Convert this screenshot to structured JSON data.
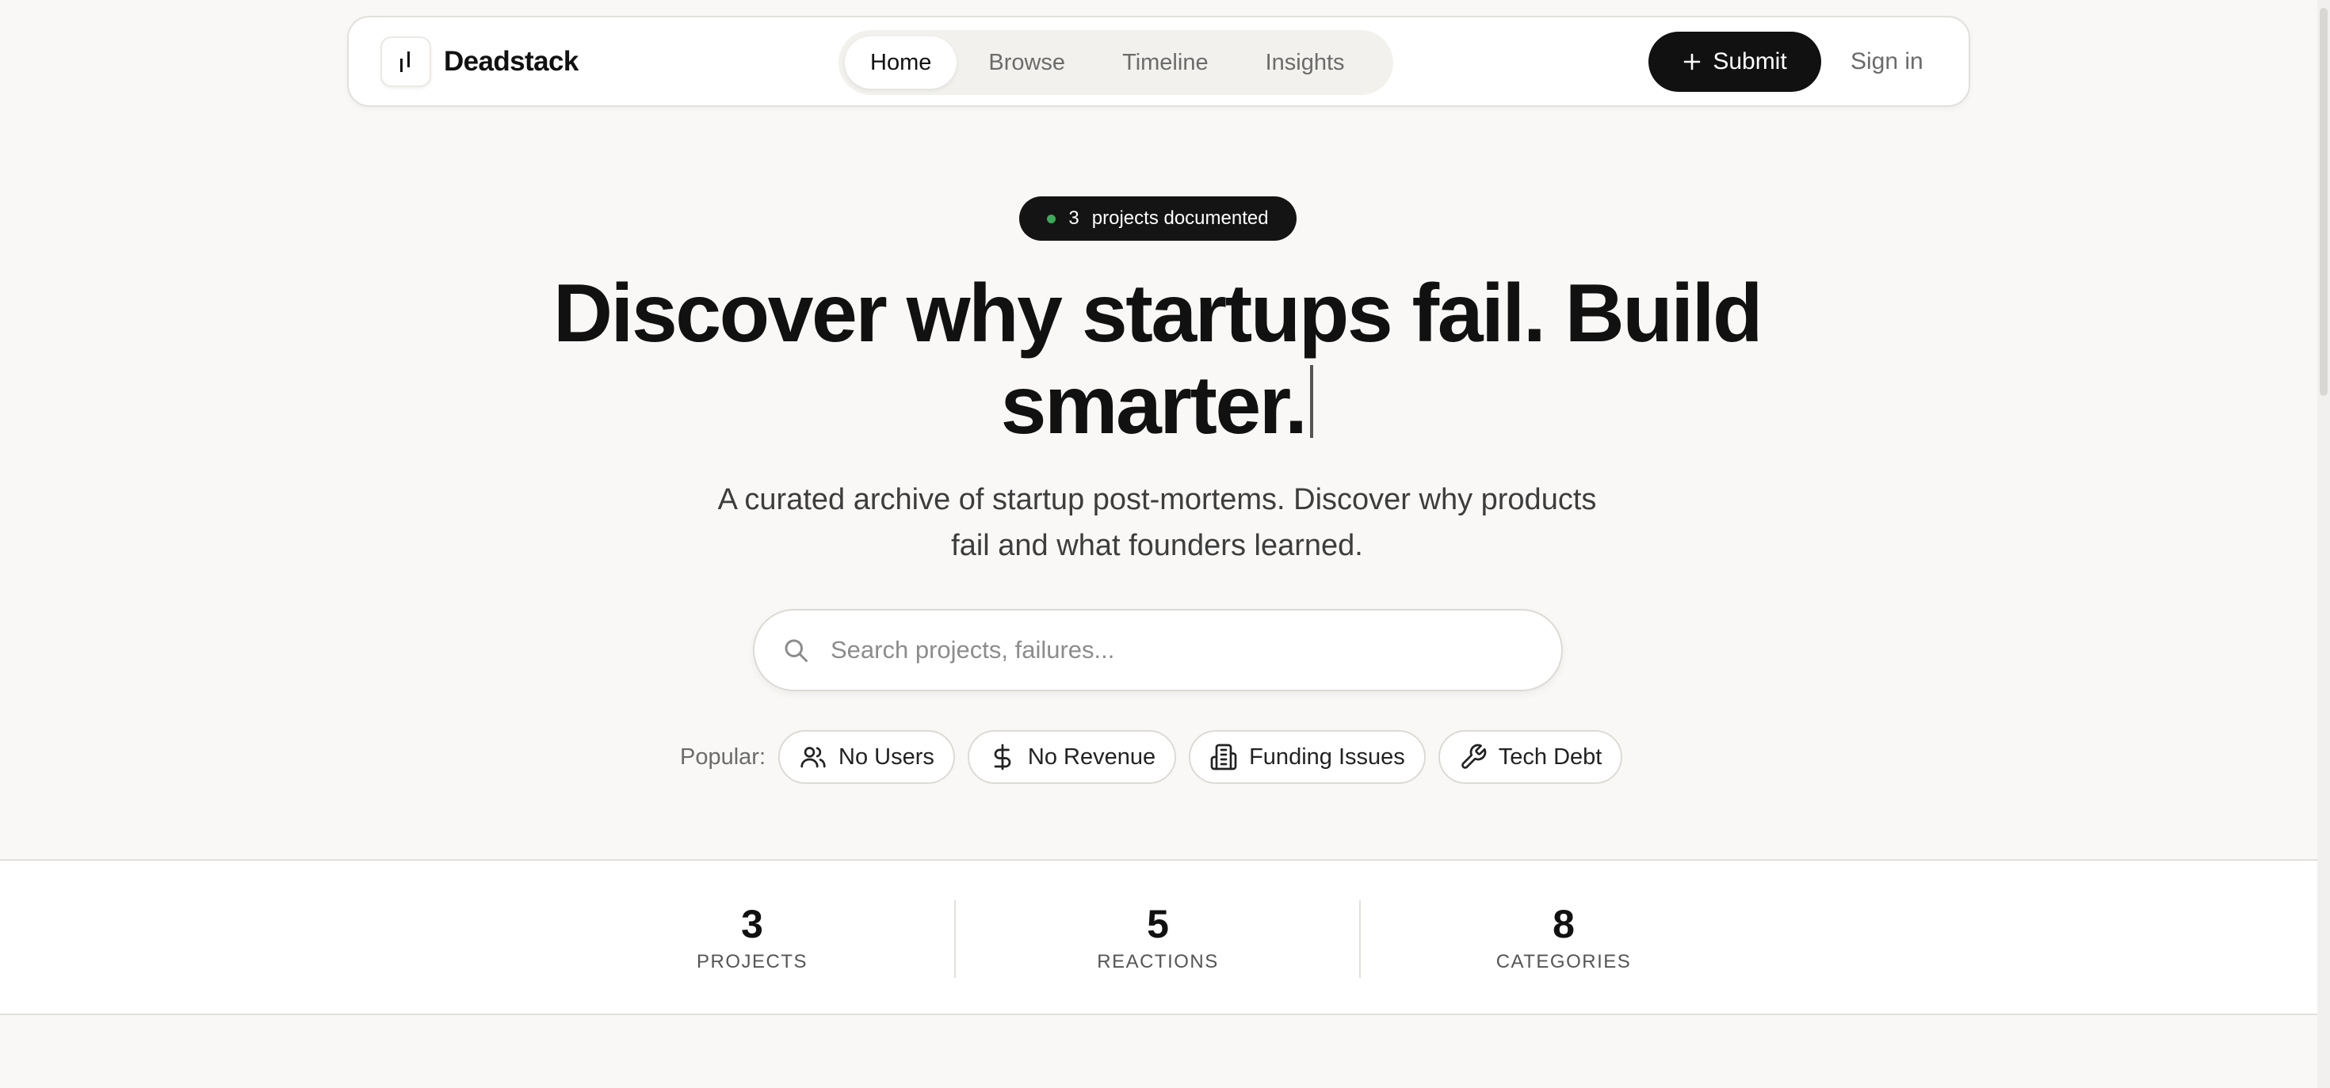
{
  "header": {
    "brand": "Deadstack",
    "nav": [
      {
        "label": "Home",
        "active": true
      },
      {
        "label": "Browse"
      },
      {
        "label": "Timeline"
      },
      {
        "label": "Insights"
      }
    ],
    "submit_label": "Submit",
    "signin_label": "Sign in"
  },
  "hero": {
    "badge_count": "3",
    "badge_text": "projects documented",
    "title_line1": "Discover why startups fail. Build",
    "title_line2": "smarter.",
    "subtitle_line1": "A curated archive of startup post-mortems. Discover why products",
    "subtitle_line2": "fail and what founders learned."
  },
  "search": {
    "placeholder": "Search projects, failures...",
    "value": ""
  },
  "popular": {
    "label": "Popular:",
    "tags": [
      {
        "label": "No Users",
        "icon": "users-icon"
      },
      {
        "label": "No Revenue",
        "icon": "dollar-icon"
      },
      {
        "label": "Funding Issues",
        "icon": "building-icon"
      },
      {
        "label": "Tech Debt",
        "icon": "wrench-icon"
      }
    ]
  },
  "stats": [
    {
      "value": "3",
      "label": "PROJECTS"
    },
    {
      "value": "5",
      "label": "REACTIONS"
    },
    {
      "value": "8",
      "label": "CATEGORIES"
    }
  ],
  "colors": {
    "background": "#f9f8f6",
    "primary": "#111111",
    "live_dot": "#3fa95b",
    "muted_text": "#6b6b6b"
  }
}
